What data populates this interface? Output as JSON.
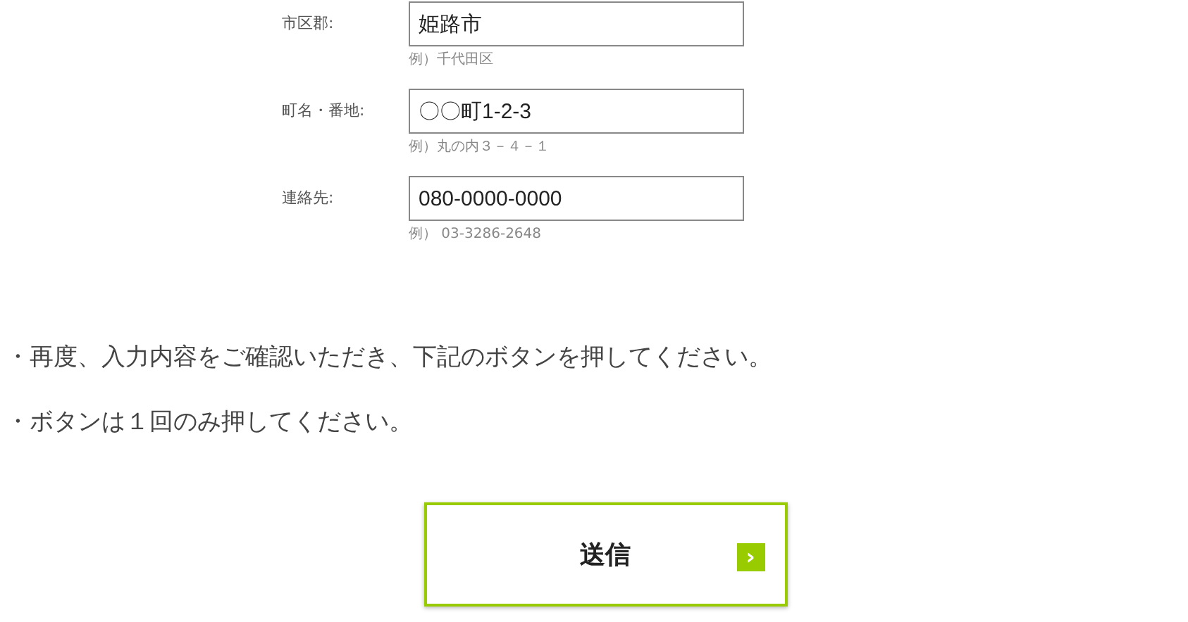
{
  "fields": [
    {
      "label": "市区郡:",
      "value": "姫路市",
      "hint": "例）千代田区"
    },
    {
      "label": "町名・番地:",
      "value": "〇〇町1-2-3",
      "hint": "例）丸の内３－４－１"
    },
    {
      "label": "連絡先:",
      "value": "080-0000-0000",
      "hint": "例） 03-3286-2648"
    }
  ],
  "notes": [
    "・再度、入力内容をご確認いただき、下記のボタンを押してください。",
    "・ボタンは１回のみ押してください。"
  ],
  "submit_button": {
    "label": "送信",
    "arrow": "›"
  }
}
